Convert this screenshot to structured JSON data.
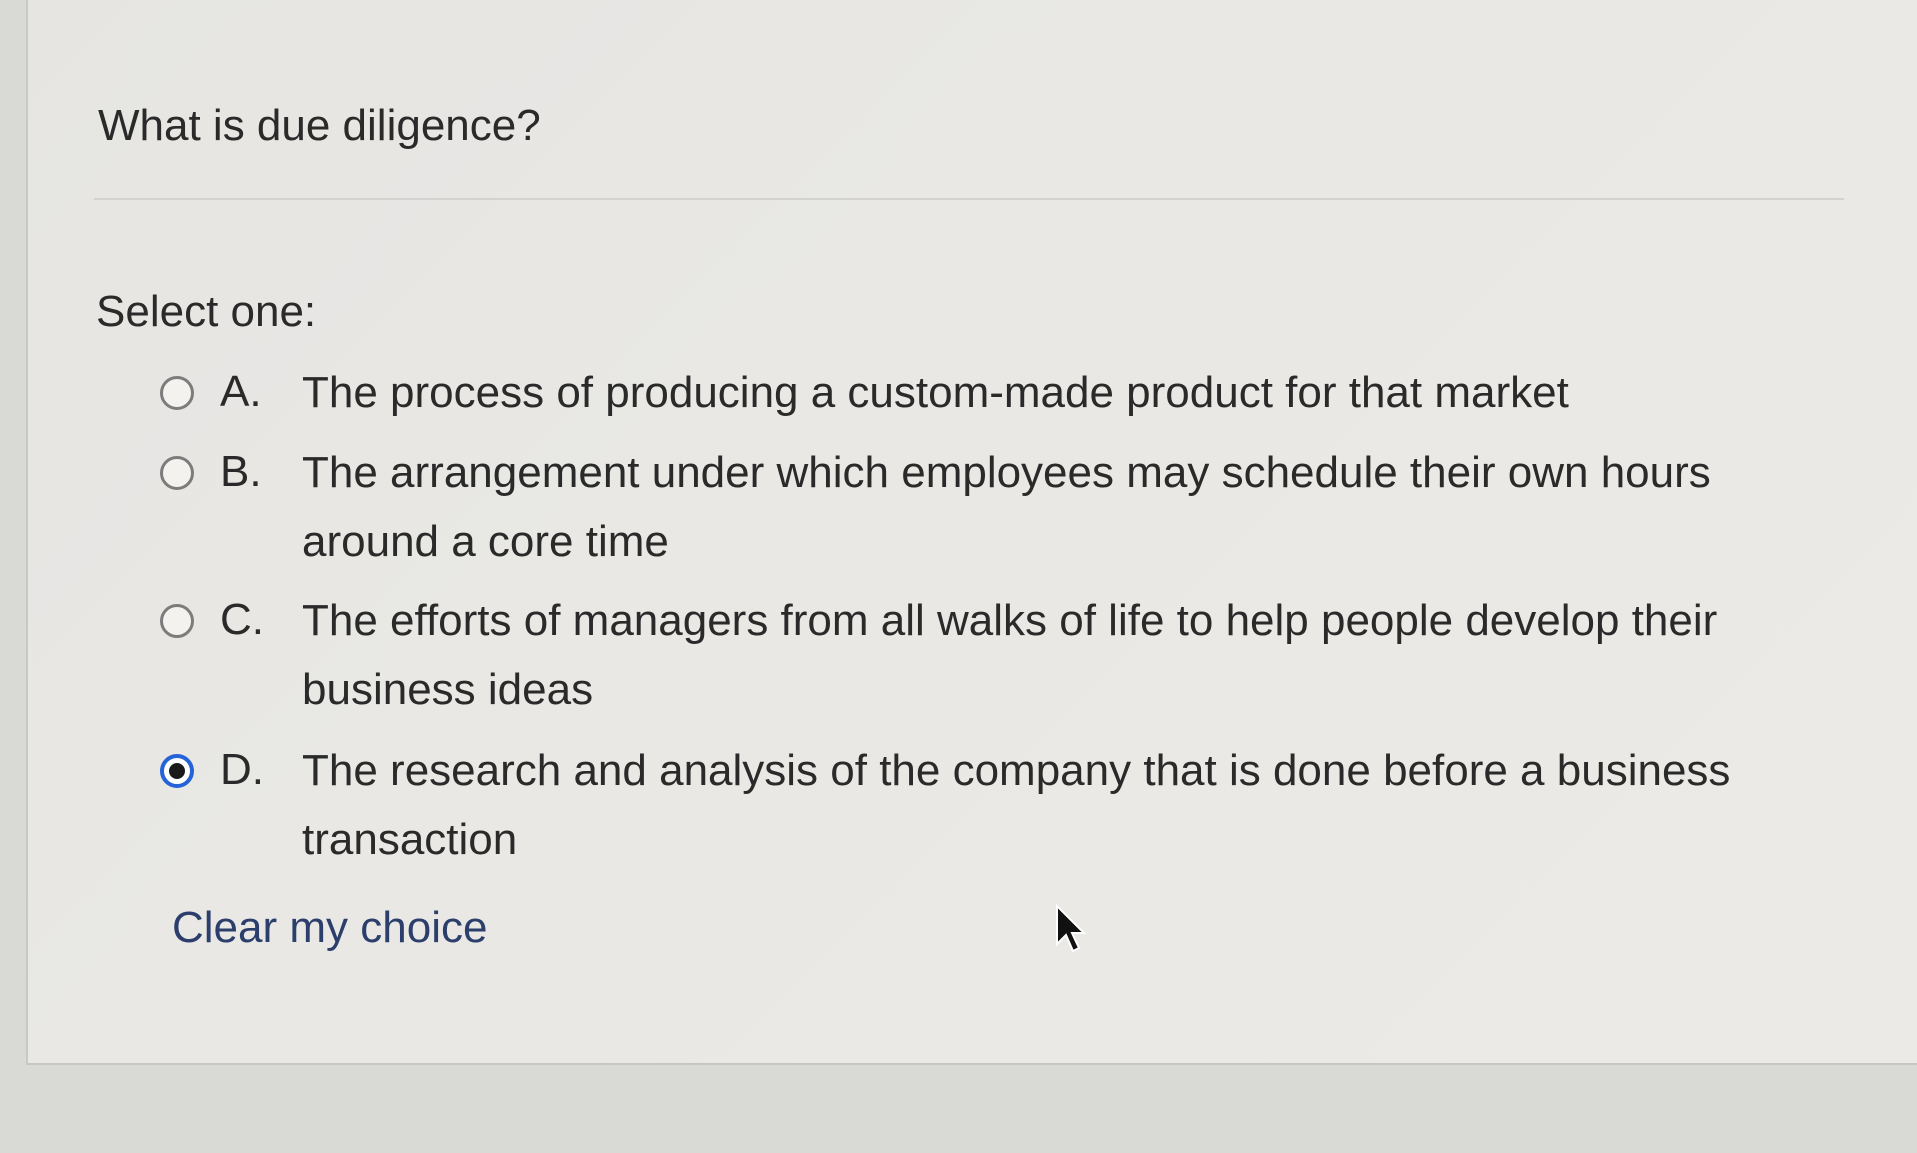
{
  "question": {
    "text": "What is due diligence?"
  },
  "prompt": "Select one:",
  "options": [
    {
      "letter": "A.",
      "text": "The process of producing a custom-made product for that market",
      "selected": false
    },
    {
      "letter": "B.",
      "text": "The arrangement under which employees may schedule their own hours around a core time",
      "selected": false
    },
    {
      "letter": "C.",
      "text": "The efforts of managers from all walks of life to help people develop their business ideas",
      "selected": false
    },
    {
      "letter": "D.",
      "text": "The research and analysis of the company that is done before a business transaction",
      "selected": true
    }
  ],
  "clear_choice_label": "Clear my choice",
  "colors": {
    "selected_radio": "#2563d8",
    "top_bar": "#6f93b8",
    "link": "#2c3e6b"
  },
  "icons": {
    "cursor": "mouse-pointer-icon"
  }
}
